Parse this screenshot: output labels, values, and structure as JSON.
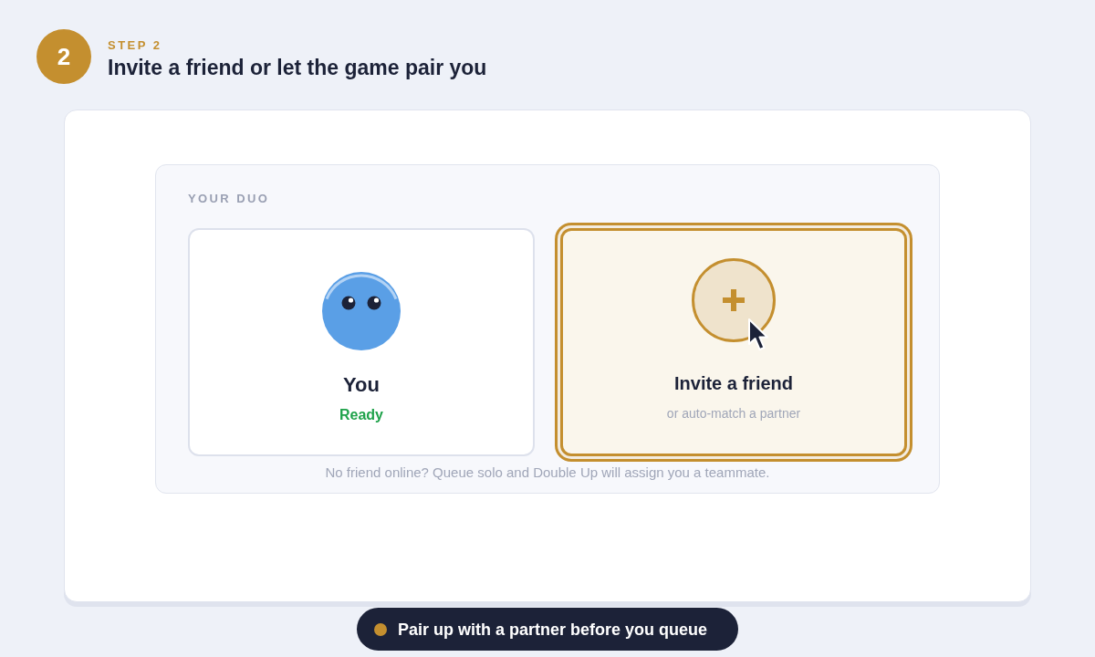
{
  "step": {
    "number": "2",
    "label": "STEP 2",
    "title": "Invite a friend or let the game pair you"
  },
  "duo": {
    "heading": "YOUR DUO",
    "slots": [
      {
        "kind": "player",
        "name": "You",
        "status": "Ready",
        "selected": false
      },
      {
        "kind": "invite",
        "title": "Invite a friend",
        "subtitle": "or auto-match a partner",
        "selected": true
      }
    ],
    "note": "No friend online? Queue solo and Double Up will assign you a teammate."
  },
  "banner": {
    "text": "Pair up with a partner before you queue"
  }
}
